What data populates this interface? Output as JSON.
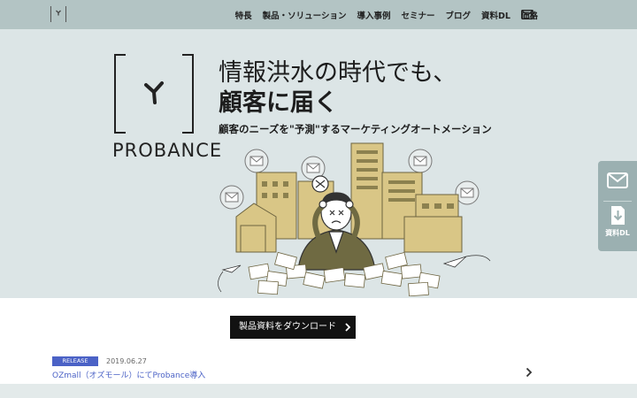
{
  "header": {
    "nav": [
      "特長",
      "製品・ソリューション",
      "導入事例",
      "セミナー",
      "ブログ",
      "資料DL",
      "価格"
    ]
  },
  "hero": {
    "brand_name": "PROBANCE",
    "headline_line1": "情報洪水の時代でも、",
    "headline_line2": "顧客に届く",
    "tagline": "顧客のニーズを\"予測\"するマーケティングオートメーション"
  },
  "side": {
    "download_label": "資料DL"
  },
  "content": {
    "download_button_label": "製品資料をダウンロード",
    "news": {
      "badge": "RELEASE",
      "date": "2019.06.27",
      "title": "OZmall（オズモール）にてProbance導入"
    }
  },
  "colors": {
    "header_bg": "#b3c4c4",
    "hero_bg": "#dce5e6",
    "side_tab_bg": "#9bb0b1",
    "badge_bg": "#4b62c6",
    "building_fill": "#d9c686"
  },
  "icons": {
    "mail": "mail-icon",
    "download": "download-icon",
    "arrow": "chevron-right-icon"
  }
}
